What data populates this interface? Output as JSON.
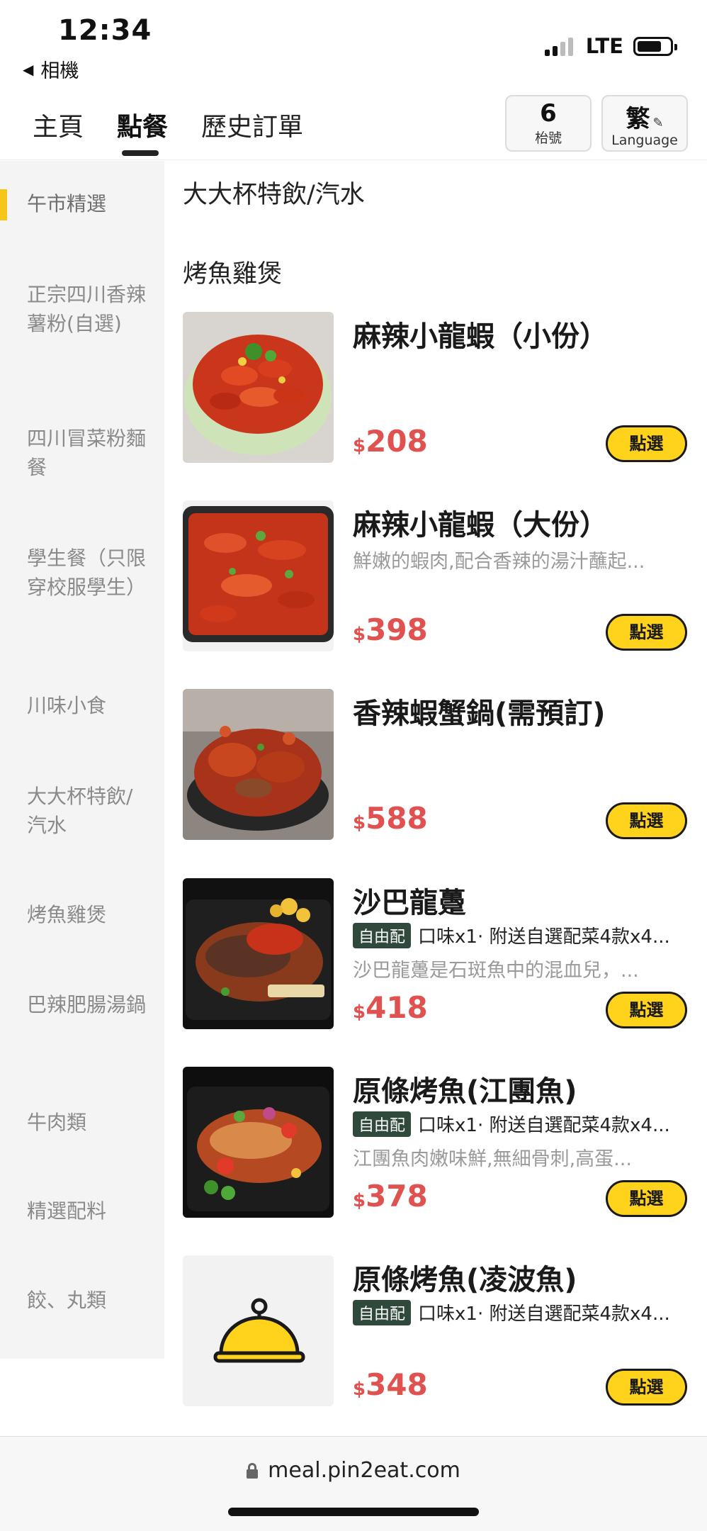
{
  "status_bar": {
    "time": "12:34",
    "back_label": "相機",
    "network": "LTE"
  },
  "header": {
    "tabs": [
      {
        "label": "主頁"
      },
      {
        "label": "點餐"
      },
      {
        "label": "歷史訂單"
      }
    ],
    "active_tab": "點餐",
    "table": {
      "number": "6",
      "label": "枱號"
    },
    "language": {
      "char": "繁",
      "label": "Language"
    }
  },
  "sidebar": {
    "items": [
      {
        "label": "午市精選"
      },
      {
        "label": "正宗四川香辣薯粉(自選)"
      },
      {
        "label": "四川冒菜粉麵餐"
      },
      {
        "label": "學生餐（只限穿校服學生）"
      },
      {
        "label": "川味小食"
      },
      {
        "label": "大大杯特飲/汽水"
      },
      {
        "label": "烤魚雞煲"
      },
      {
        "label": "巴辣肥腸湯鍋"
      },
      {
        "label": "牛肉類"
      },
      {
        "label": "精選配料"
      },
      {
        "label": "餃、丸類"
      }
    ]
  },
  "main": {
    "section_prev": "大大杯特飲/汽水",
    "section_title": "烤魚雞煲",
    "select_label": "點選",
    "currency": "$",
    "items": [
      {
        "name": "麻辣小龍蝦（小份）",
        "price": "208",
        "tag": "",
        "tag_desc": "",
        "desc": "",
        "image": "crayfish-dish"
      },
      {
        "name": "麻辣小龍蝦（大份）",
        "price": "398",
        "tag": "",
        "tag_desc": "",
        "desc": "鮮嫩的蝦肉,配合香辣的湯汁蘸起...",
        "image": "crayfish-tray"
      },
      {
        "name": "香辣蝦蟹鍋(需預訂)",
        "price": "588",
        "tag": "",
        "tag_desc": "",
        "desc": "",
        "image": "crab-pot"
      },
      {
        "name": "沙巴龍躉",
        "price": "418",
        "tag": "自由配",
        "tag_desc": "口味x1· 附送自選配菜4款x4...",
        "desc": "沙巴龍躉是石斑魚中的混血兒，...",
        "image": "grilled-fish"
      },
      {
        "name": "原條烤魚(江團魚)",
        "price": "378",
        "tag": "自由配",
        "tag_desc": "口味x1· 附送自選配菜4款x4...",
        "desc": "江團魚肉嫩味鮮,無細骨刺,高蛋...",
        "image": "grilled-fish-tray"
      },
      {
        "name": "原條烤魚(凌波魚)",
        "price": "348",
        "tag": "自由配",
        "tag_desc": "口味x1· 附送自選配菜4款x4...",
        "desc": "",
        "image": "cloche-placeholder"
      }
    ]
  },
  "url_bar": {
    "url": "meal.pin2eat.com"
  },
  "colors": {
    "accent_yellow": "#ffd21c",
    "price_red": "#e0524f",
    "tag_green": "#2f4a3c",
    "sidebar_bg": "#f4f4f4"
  }
}
